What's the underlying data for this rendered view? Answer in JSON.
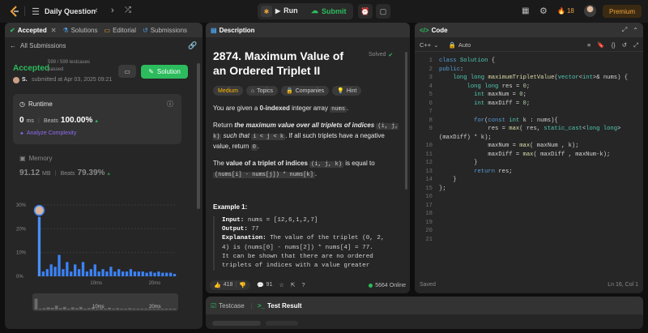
{
  "topbar": {
    "title": "Daily Question",
    "run_label": "Run",
    "submit_label": "Submit",
    "streak": "18",
    "premium_label": "Premium"
  },
  "left": {
    "tabs": [
      "Accepted",
      "Solutions",
      "Editorial",
      "Submissions"
    ],
    "all_submissions": "All Submissions",
    "status": "Accepted",
    "testcases": "599 / 599 testcases",
    "passed": "passed",
    "user": "S.",
    "submitted_at": "submitted at Apr 03, 2025 09:21",
    "solution_label": "Solution",
    "runtime": {
      "label": "Runtime",
      "value": "0",
      "unit": "ms",
      "beats_label": "Beats",
      "beats_value": "100.00%",
      "analyze": "Analyze Complexity"
    },
    "memory": {
      "label": "Memory",
      "value": "91.12",
      "unit": "MB",
      "beats_label": "Beats",
      "beats_value": "79.39%"
    },
    "chart": {
      "y_ticks": [
        "30%",
        "20%",
        "10%",
        "0%"
      ],
      "x_ticks": [
        "10ms",
        "20ms"
      ],
      "mini_ticks": [
        "10ms",
        "20ms"
      ]
    }
  },
  "chart_data": {
    "type": "bar",
    "ylim": [
      0,
      30
    ],
    "values": [
      25,
      2,
      3,
      5,
      4,
      9,
      3,
      6,
      2,
      5,
      3,
      6,
      2,
      3,
      5,
      2,
      3,
      2,
      4,
      2,
      3,
      2,
      2,
      3,
      2,
      2,
      2,
      1.5,
      2,
      1.5,
      2,
      1.5,
      1.5,
      1.5,
      1
    ],
    "highlight_index": 0,
    "series_color": "#3b82f6"
  },
  "description": {
    "tab": "Description",
    "title": "2874. Maximum Value of an Ordered Triplet II",
    "solved": "Solved",
    "tags": [
      "Medium",
      "Topics",
      "Companies",
      "Hint"
    ],
    "p1_a": "You are given a ",
    "p1_b": "0-indexed",
    "p1_c": " integer array ",
    "p1_code": "nums",
    "p1_d": ".",
    "p2_a": "Return ",
    "p2_b": "the maximum value over all triplets of indices",
    "p2_code1": "(i, j, k)",
    "p2_c": " such that ",
    "p2_code2": "i < j < k",
    "p2_d": ". If all such triplets have a negative value, return ",
    "p2_code3": "0",
    "p2_e": ".",
    "p3_a": "The ",
    "p3_b": "value of a triplet of indices",
    "p3_code1": "(i, j, k)",
    "p3_c": " is equal to ",
    "p3_code2": "(nums[i] - nums[j]) * nums[k]",
    "p3_d": ".",
    "example_title": "Example 1:",
    "input_label": "Input:",
    "input_value": " nums = [12,6,1,2,7]",
    "output_label": "Output:",
    "output_value": " 77",
    "expl_label": "Explanation:",
    "expl_lines": [
      " The value of the triplet (0, 2,",
      "4) is (nums[0] - nums[2]) * nums[4] = 77.",
      "It can be shown that there are no ordered",
      "triplets of indices with a value greater"
    ],
    "likes": "418",
    "comments": "91",
    "online": "5664 Online"
  },
  "code": {
    "tab": "Code",
    "language": "C++",
    "mode": "Auto",
    "saved": "Saved",
    "cursor": "Ln 16, Col 1",
    "lines": [
      "class Solution {",
      "public:",
      "    long long maximumTripletValue(vector<int>& nums) {",
      "        long long res = 0;",
      "          int maxNum = 0;",
      "          int maxDiff = 0;",
      "",
      "          for(const int k : nums){",
      "              res = max( res, static_cast<long long>",
      "(maxDiff) * k);",
      "              maxNum = max( maxNum , k);",
      "              maxDiff = max( maxDiff , maxNum-k);",
      "          }",
      "          return res;",
      "    }",
      "};",
      "",
      "",
      "",
      "",
      "",
      ""
    ],
    "line_numbers": [
      "1",
      "2",
      "3",
      "4",
      "5",
      "6",
      "7",
      "8",
      "9",
      "",
      "10",
      "11",
      "12",
      "13",
      "14",
      "15",
      "16",
      "17",
      "18",
      "19",
      "20",
      "21",
      "22"
    ]
  },
  "bottom": {
    "testcase_tab": "Testcase",
    "result_tab": "Test Result"
  }
}
